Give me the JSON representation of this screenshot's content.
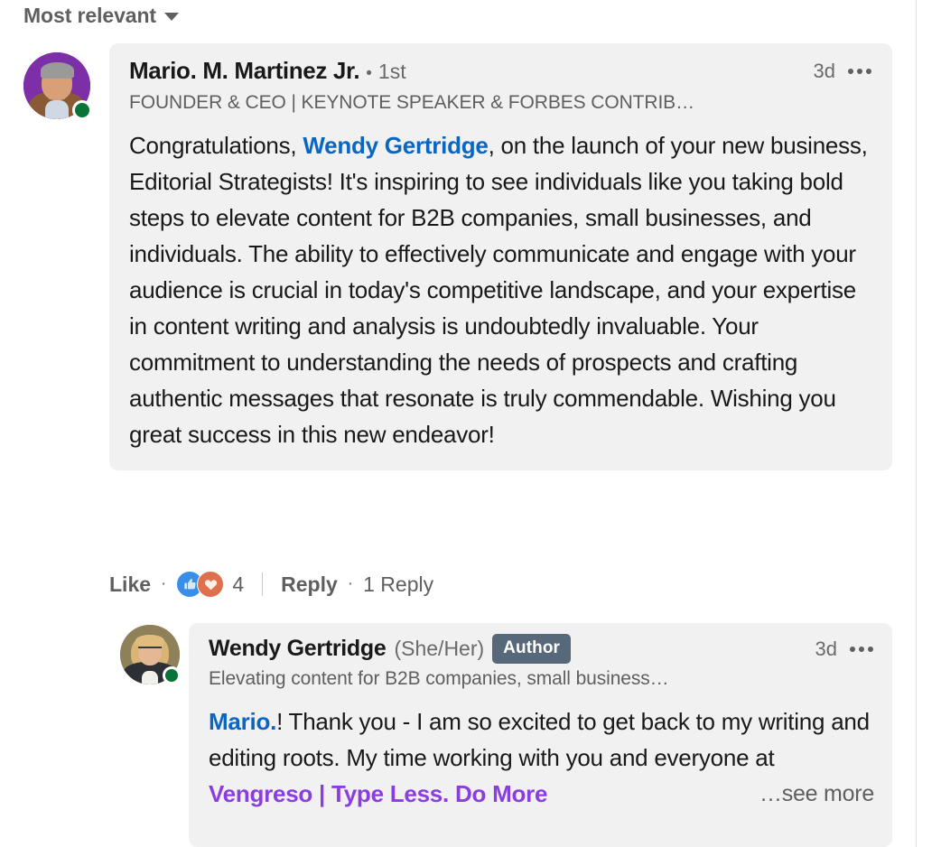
{
  "sort": {
    "label": "Most relevant",
    "caret_icon": "chevron-down-icon"
  },
  "comment": {
    "author_name": "Mario. M. Martinez Jr.",
    "separator": "•",
    "degree": "1st",
    "headline": "FOUNDER & CEO | KEYNOTE SPEAKER & FORBES CONTRIB…",
    "timestamp": "3d",
    "menu_icon": "ellipsis-icon",
    "avatar_alt": "avatar",
    "presence": "online",
    "body_pre": "Congratulations, ",
    "body_mention": "Wendy Gertridge",
    "body_post": ", on the launch of your new business, Editorial Strategists! It's inspiring to see individuals like you taking bold steps to elevate content for B2B companies, small businesses, and individuals. The ability to effectively communicate and engage with your audience is crucial in today's competitive landscape, and your expertise in content writing and analysis is undoubtedly invaluable. Your commitment to understanding the needs of prospects and crafting authentic messages that resonate is truly commendable. Wishing you great success in this new endeavor!"
  },
  "actions": {
    "like_label": "Like",
    "dot": "·",
    "reaction_like_icon": "thumbs-up-icon",
    "reaction_love_icon": "heart-icon",
    "reaction_count": "4",
    "reply_label": "Reply",
    "reply_count_label": "1 Reply"
  },
  "reply": {
    "author_name": "Wendy Gertridge",
    "pronouns": "(She/Her)",
    "badge": "Author",
    "headline": "Elevating content for B2B companies, small business…",
    "timestamp": "3d",
    "menu_icon": "ellipsis-icon",
    "avatar_alt": "avatar",
    "presence": "online",
    "body_mention": "Mario.",
    "body_mid": "! Thank you - I am so excited to get back to my writing and editing roots. My time working with you and everyone at ",
    "body_link": "Vengreso | Type Less. Do More",
    "see_more": "…see more"
  },
  "colors": {
    "mention_blue": "#0a66c2",
    "link_purple": "#8a3ee0",
    "card_bg": "#f1f1f1",
    "badge_bg": "#56687a",
    "presence_green": "#0a7338",
    "reaction_like_bg": "#378fe9",
    "reaction_love_bg": "#df704d"
  }
}
